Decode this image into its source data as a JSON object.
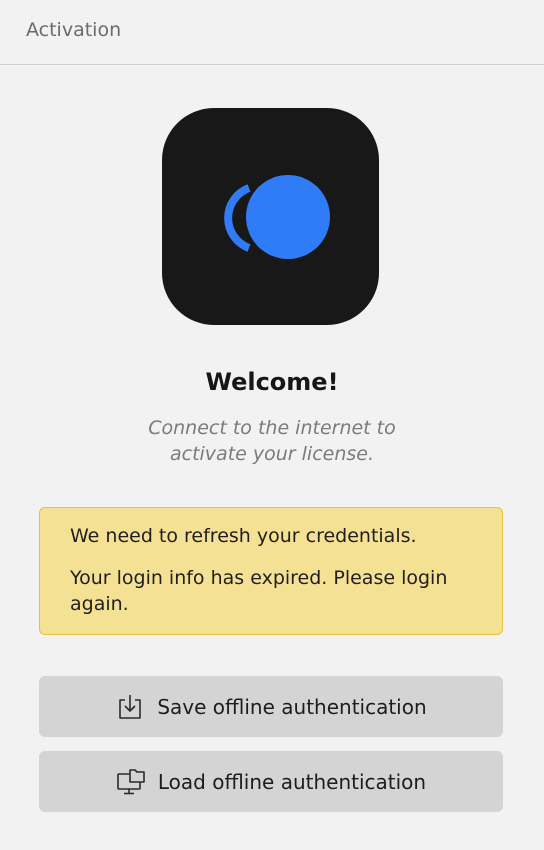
{
  "header": {
    "title": "Activation"
  },
  "logo": {
    "icon": "app-logo-icon",
    "background": "#181818",
    "accent": "#2f7cf6"
  },
  "welcome": {
    "title": "Welcome!",
    "subtitle": "Connect to the internet to activate your license."
  },
  "alert": {
    "title": "We need to refresh your credentials.",
    "message": "Your login info has expired. Please login again.",
    "background": "#f5e193",
    "border": "#e6c23b"
  },
  "actions": {
    "save": {
      "label": "Save offline authentication",
      "icon": "download-icon"
    },
    "load": {
      "label": "Load offline authentication",
      "icon": "monitor-folder-icon"
    }
  }
}
